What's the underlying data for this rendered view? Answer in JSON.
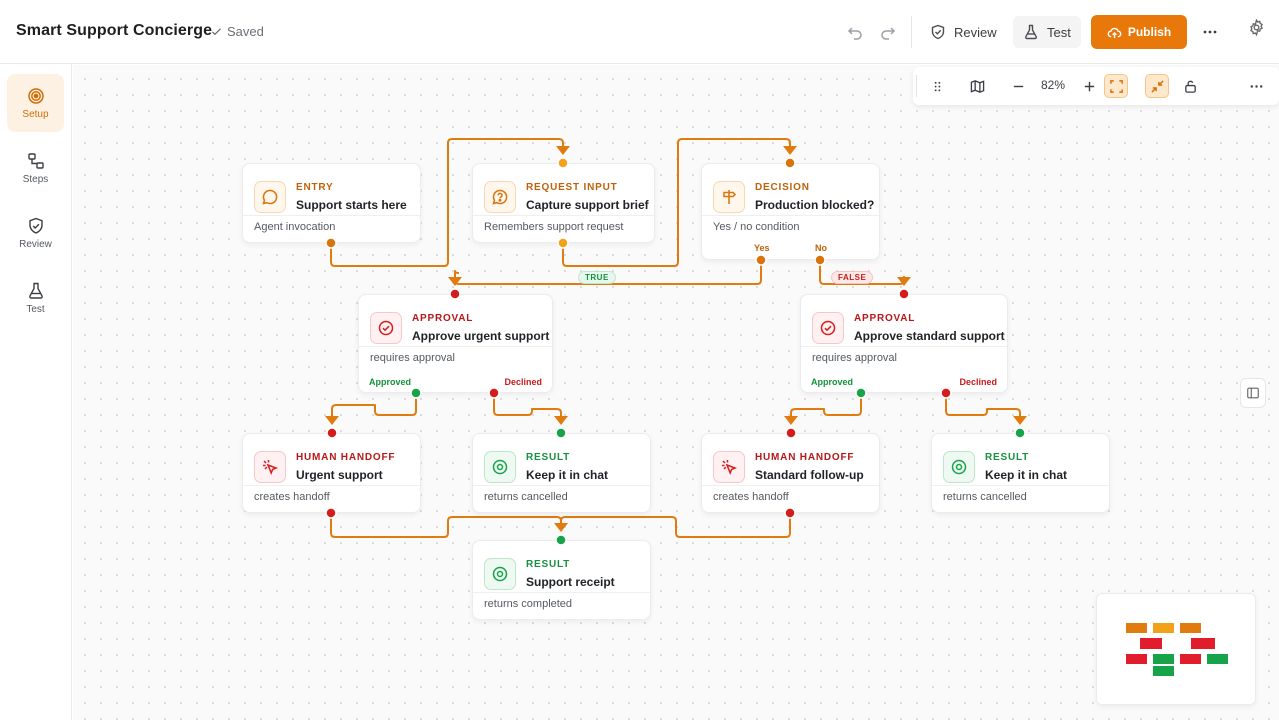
{
  "header": {
    "app_title": "Smart Support Concierge",
    "saved_status": "Saved",
    "review_label": "Review",
    "test_label": "Test",
    "publish_label": "Publish"
  },
  "sidebar": {
    "items": [
      {
        "label": "Setup",
        "icon": "target-icon",
        "active": true
      },
      {
        "label": "Steps",
        "icon": "steps-icon",
        "active": false
      },
      {
        "label": "Review",
        "icon": "shield-check-icon",
        "active": false
      },
      {
        "label": "Test",
        "icon": "flask-icon",
        "active": false
      }
    ]
  },
  "canvas_toolbar": {
    "zoom": "82%"
  },
  "nodes": {
    "entry": {
      "kind": "ENTRY",
      "title": "Support starts here",
      "sub": "Agent invocation"
    },
    "request": {
      "kind": "REQUEST INPUT",
      "title": "Capture support brief",
      "sub": "Remembers support request"
    },
    "decision": {
      "kind": "DECISION",
      "title": "Production blocked?",
      "sub": "Yes / no condition"
    },
    "approval_urgent": {
      "kind": "APPROVAL",
      "title": "Approve urgent support",
      "sub": "requires approval",
      "approved": "Approved",
      "declined": "Declined"
    },
    "approval_standard": {
      "kind": "APPROVAL",
      "title": "Approve standard support",
      "sub": "requires approval",
      "approved": "Approved",
      "declined": "Declined"
    },
    "handoff_urgent": {
      "kind": "HUMAN HANDOFF",
      "title": "Urgent support",
      "sub": "creates handoff"
    },
    "result_chat_1": {
      "kind": "RESULT",
      "title": "Keep it in chat",
      "sub": "returns cancelled"
    },
    "handoff_standard": {
      "kind": "HUMAN HANDOFF",
      "title": "Standard follow-up",
      "sub": "creates handoff"
    },
    "result_chat_2": {
      "kind": "RESULT",
      "title": "Keep it in chat",
      "sub": "returns cancelled"
    },
    "result_receipt": {
      "kind": "RESULT",
      "title": "Support receipt",
      "sub": "returns completed"
    }
  },
  "edge_labels": {
    "yes": "Yes",
    "no": "No",
    "true_pill": "TRUE",
    "false_pill": "FALSE"
  },
  "colors": {
    "accent": "#e8780a",
    "edge": "#e07b10",
    "approval_red": "#d51c1c",
    "result_green": "#16a34a"
  }
}
